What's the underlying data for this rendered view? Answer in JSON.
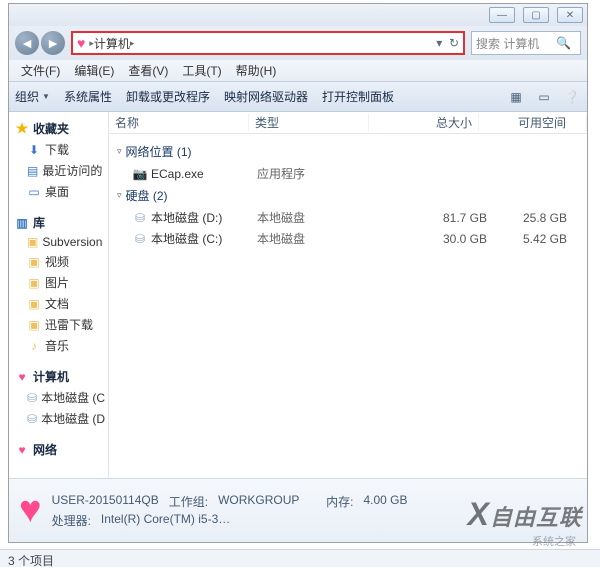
{
  "titlebar": {
    "min": "—",
    "max": "▢",
    "close": "✕"
  },
  "address": {
    "crumb1": "计算机",
    "chev": "▸",
    "refresh": "↻",
    "search_placeholder": "搜索 计算机"
  },
  "menu": {
    "file": "文件(F)",
    "edit": "编辑(E)",
    "view": "查看(V)",
    "tools": "工具(T)",
    "help": "帮助(H)"
  },
  "toolbar": {
    "organize": "组织",
    "sysprops": "系统属性",
    "uninstall": "卸载或更改程序",
    "mapdrive": "映射网络驱动器",
    "ctrlpanel": "打开控制面板"
  },
  "sidebar": {
    "fav": "收藏夹",
    "fav_items": [
      "下载",
      "最近访问的",
      "桌面"
    ],
    "lib": "库",
    "lib_items": [
      "Subversion",
      "视频",
      "图片",
      "文档",
      "迅雷下载",
      "音乐"
    ],
    "computer": "计算机",
    "drives": [
      "本地磁盘 (C",
      "本地磁盘 (D"
    ],
    "network": "网络"
  },
  "columns": {
    "name": "名称",
    "type": "类型",
    "total": "总大小",
    "free": "可用空间"
  },
  "groups": {
    "net": {
      "label": "网络位置 (1)"
    },
    "hdd": {
      "label": "硬盘 (2)"
    }
  },
  "items": {
    "ecap": {
      "name": "ECap.exe",
      "type": "应用程序"
    },
    "d": {
      "name": "本地磁盘 (D:)",
      "type": "本地磁盘",
      "total": "81.7 GB",
      "free": "25.8 GB"
    },
    "c": {
      "name": "本地磁盘 (C:)",
      "type": "本地磁盘",
      "total": "30.0 GB",
      "free": "5.42 GB"
    }
  },
  "details": {
    "name": "USER-20150114QB",
    "wg_label": "工作组:",
    "wg": "WORKGROUP",
    "cpu_label": "处理器:",
    "cpu": "Intel(R) Core(TM) i5-3…",
    "mem_label": "内存:",
    "mem": "4.00 GB"
  },
  "status": {
    "count": "3 个项目"
  },
  "watermark": {
    "brand": "自由互联",
    "sub": "系统之家"
  }
}
